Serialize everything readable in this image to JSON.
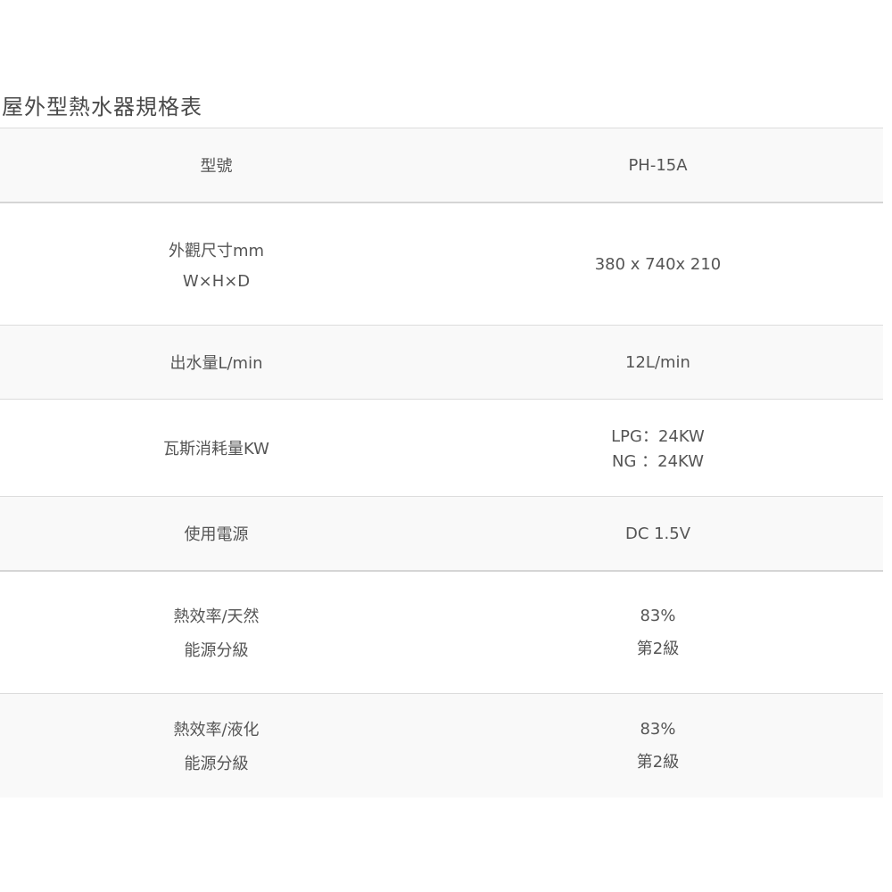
{
  "title": "屋外型熱水器規格表",
  "rows": [
    {
      "label": [
        "型號"
      ],
      "value": [
        "PH-15A"
      ]
    },
    {
      "label": [
        "外觀尺寸mm",
        "W×H×D"
      ],
      "value": [
        "380 x 740x 210"
      ]
    },
    {
      "label": [
        "出水量L/min"
      ],
      "value": [
        "12L/min"
      ]
    },
    {
      "label": [
        "瓦斯消耗量KW"
      ],
      "value": [
        "LPG：24KW",
        "NG ：24KW"
      ]
    },
    {
      "label": [
        "使用電源"
      ],
      "value": [
        "DC  1.5V"
      ]
    },
    {
      "label": [
        "熱效率/天然",
        "能源分級"
      ],
      "value": [
        "83%",
        "第2級"
      ]
    },
    {
      "label": [
        "熱效率/液化",
        "能源分級"
      ],
      "value": [
        "83%",
        "第2級"
      ]
    }
  ]
}
